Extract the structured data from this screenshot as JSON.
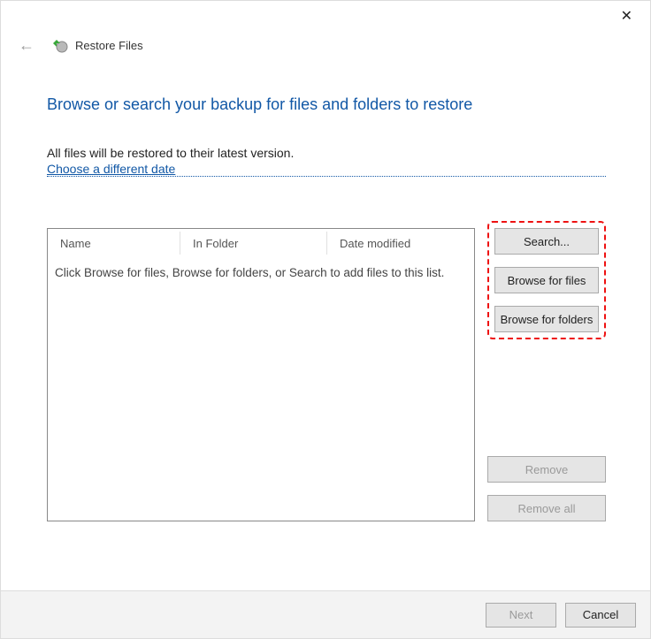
{
  "header": {
    "title": "Restore Files"
  },
  "page": {
    "title": "Browse or search your backup for files and folders to restore",
    "info": "All files will be restored to their latest version.",
    "link": "Choose a different date"
  },
  "list": {
    "columns": {
      "name": "Name",
      "folder": "In Folder",
      "date": "Date modified"
    },
    "placeholder": "Click Browse for files, Browse for folders, or Search to add files to this list."
  },
  "buttons": {
    "search": "Search...",
    "browse_files": "Browse for files",
    "browse_folders": "Browse for folders",
    "remove": "Remove",
    "remove_all": "Remove all"
  },
  "footer": {
    "next": "Next",
    "cancel": "Cancel"
  }
}
